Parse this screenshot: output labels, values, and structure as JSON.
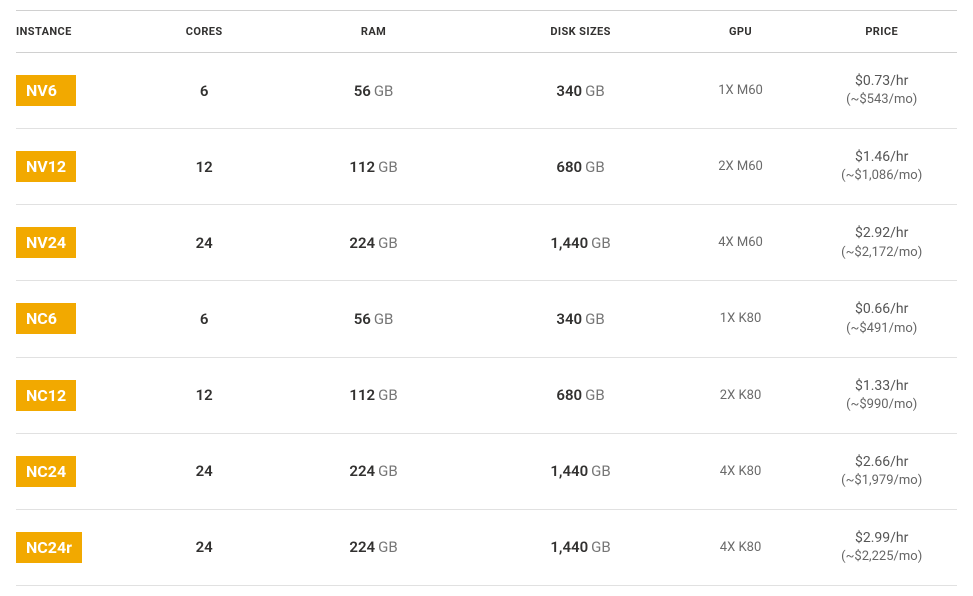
{
  "headers": {
    "instance": "INSTANCE",
    "cores": "CORES",
    "ram": "RAM",
    "disk": "DISK SIZES",
    "gpu": "GPU",
    "price": "PRICE"
  },
  "ram_unit": "GB",
  "disk_unit": "GB",
  "rows": [
    {
      "instance": "NV6",
      "cores": "6",
      "ram": "56",
      "disk": "340",
      "gpu": "1X M60",
      "price_hr": "$0.73/hr",
      "price_mo": "(~$543/mo)"
    },
    {
      "instance": "NV12",
      "cores": "12",
      "ram": "112",
      "disk": "680",
      "gpu": "2X M60",
      "price_hr": "$1.46/hr",
      "price_mo": "(~$1,086/mo)"
    },
    {
      "instance": "NV24",
      "cores": "24",
      "ram": "224",
      "disk": "1,440",
      "gpu": "4X M60",
      "price_hr": "$2.92/hr",
      "price_mo": "(~$2,172/mo)"
    },
    {
      "instance": "NC6",
      "cores": "6",
      "ram": "56",
      "disk": "340",
      "gpu": "1X K80",
      "price_hr": "$0.66/hr",
      "price_mo": "(~$491/mo)"
    },
    {
      "instance": "NC12",
      "cores": "12",
      "ram": "112",
      "disk": "680",
      "gpu": "2X K80",
      "price_hr": "$1.33/hr",
      "price_mo": "(~$990/mo)"
    },
    {
      "instance": "NC24",
      "cores": "24",
      "ram": "224",
      "disk": "1,440",
      "gpu": "4X K80",
      "price_hr": "$2.66/hr",
      "price_mo": "(~$1,979/mo)"
    },
    {
      "instance": "NC24r",
      "cores": "24",
      "ram": "224",
      "disk": "1,440",
      "gpu": "4X K80",
      "price_hr": "$2.99/hr",
      "price_mo": "(~$2,225/mo)"
    }
  ],
  "chart_data": {
    "type": "table",
    "title": "",
    "columns": [
      "INSTANCE",
      "CORES",
      "RAM",
      "DISK SIZES",
      "GPU",
      "PRICE"
    ],
    "rows": [
      [
        "NV6",
        6,
        "56 GB",
        "340 GB",
        "1X M60",
        "$0.73/hr (~$543/mo)"
      ],
      [
        "NV12",
        12,
        "112 GB",
        "680 GB",
        "2X M60",
        "$1.46/hr (~$1,086/mo)"
      ],
      [
        "NV24",
        24,
        "224 GB",
        "1,440 GB",
        "4X M60",
        "$2.92/hr (~$2,172/mo)"
      ],
      [
        "NC6",
        6,
        "56 GB",
        "340 GB",
        "1X K80",
        "$0.66/hr (~$491/mo)"
      ],
      [
        "NC12",
        12,
        "112 GB",
        "680 GB",
        "2X K80",
        "$1.33/hr (~$990/mo)"
      ],
      [
        "NC24",
        24,
        "224 GB",
        "1,440 GB",
        "4X K80",
        "$2.66/hr (~$1,979/mo)"
      ],
      [
        "NC24r",
        24,
        "224 GB",
        "1,440 GB",
        "4X K80",
        "$2.99/hr (~$2,225/mo)"
      ]
    ]
  }
}
